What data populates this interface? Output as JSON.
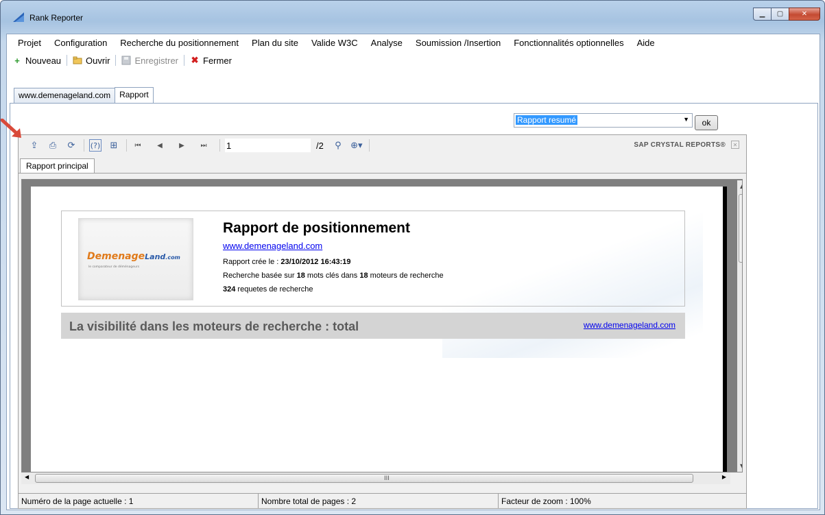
{
  "window": {
    "title": "Rank Reporter"
  },
  "menu": {
    "items": [
      "Projet",
      "Configuration",
      "Recherche du positionnement",
      "Plan du site",
      "Valide W3C",
      "Analyse",
      "Soumission /Insertion",
      "Fonctionnalités optionnelles",
      "Aide"
    ]
  },
  "toolbar": {
    "new_label": "Nouveau",
    "open_label": "Ouvrir",
    "save_label": "Enregistrer",
    "close_label": "Fermer"
  },
  "tabs": [
    "www.demenageland.com",
    "Rapport"
  ],
  "report_select": {
    "value": "Rapport resumé",
    "ok_label": "ok"
  },
  "viewer": {
    "page_number": "1",
    "page_total": "/2",
    "brand": "SAP CRYSTAL REPORTS®",
    "sub_tab": "Rapport principal"
  },
  "report": {
    "logo_main": "Demenage",
    "logo_land": "Land",
    "logo_dot": ".com",
    "logo_tag": "le comparateur de déménageurs",
    "title": "Rapport de positionnement",
    "link": "www.demenageland.com",
    "created_label": "Rapport crée le : ",
    "created_value": "23/10/2012 16:43:19",
    "search_prefix": "Recherche basée sur ",
    "keywords_count": "18",
    "search_mid": " mots clés dans ",
    "engines_count": "18",
    "search_suffix": " moteurs de recherche",
    "requests_count": "324",
    "requests_suffix": " requetes de recherche",
    "visibility_title": "La visibilité dans les moteurs de recherche  : total",
    "visibility_link": "www.demenageland.com"
  },
  "status": {
    "current_page": "Numéro de la page actuelle : 1",
    "total_pages": "Nombre total de pages : 2",
    "zoom": "Facteur de zoom : 100%"
  },
  "colors": {
    "accent_arrow": "#d94a3a",
    "link": "#0000ee",
    "select_highlight": "#3399ff"
  }
}
